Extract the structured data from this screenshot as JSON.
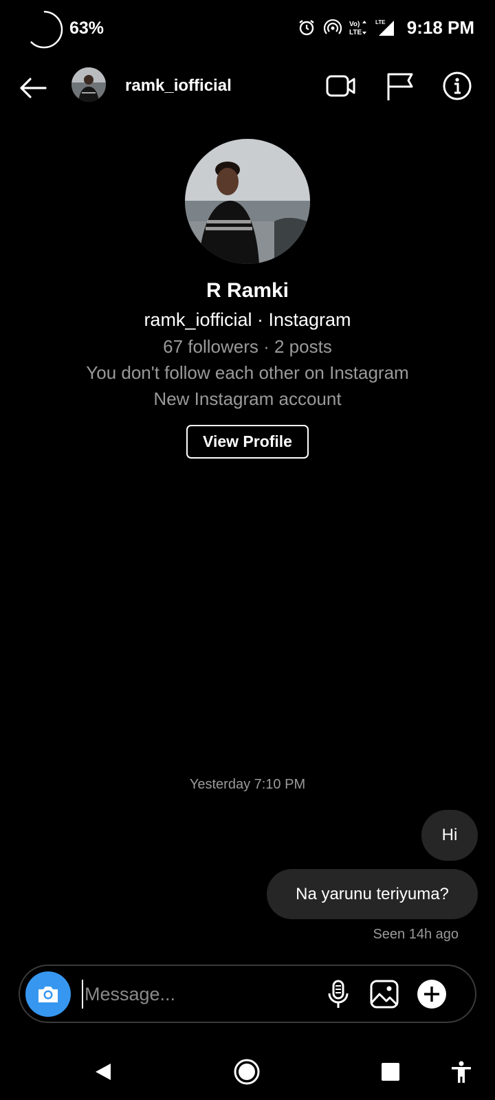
{
  "status_bar": {
    "battery_percent_label": "63%",
    "battery_level": 0.63,
    "time": "9:18 PM",
    "network_label": "Vo) LTE",
    "icons": [
      "alarm-icon",
      "hotspot-icon",
      "volte-icon",
      "signal-icon"
    ]
  },
  "header": {
    "username": "ramk_iofficial",
    "icons": [
      "back-arrow-icon",
      "video-call-icon",
      "flag-icon",
      "info-icon"
    ]
  },
  "profile": {
    "name": "R Ramki",
    "handle": "ramk_iofficial · Instagram",
    "stats": "67 followers · 2 posts",
    "follow_status": "You don't follow each other on Instagram",
    "account_note": "New Instagram account",
    "view_profile_label": "View Profile"
  },
  "messages": {
    "timestamp": "Yesterday 7:10 PM",
    "items": [
      {
        "text": "Hi",
        "sender": "me"
      },
      {
        "text": "Na yarunu teriyuma?",
        "sender": "me"
      }
    ],
    "seen": "Seen 14h ago"
  },
  "composer": {
    "placeholder": "Message...",
    "icons": [
      "camera-icon",
      "microphone-icon",
      "gallery-icon",
      "plus-icon"
    ]
  },
  "nav_bar": {
    "icons": [
      "nav-back-icon",
      "nav-home-icon",
      "nav-recents-icon",
      "accessibility-icon"
    ]
  },
  "colors": {
    "background": "#000000",
    "bubble": "#262626",
    "secondary_text": "#9a9a9a",
    "accent": "#3797f0"
  }
}
